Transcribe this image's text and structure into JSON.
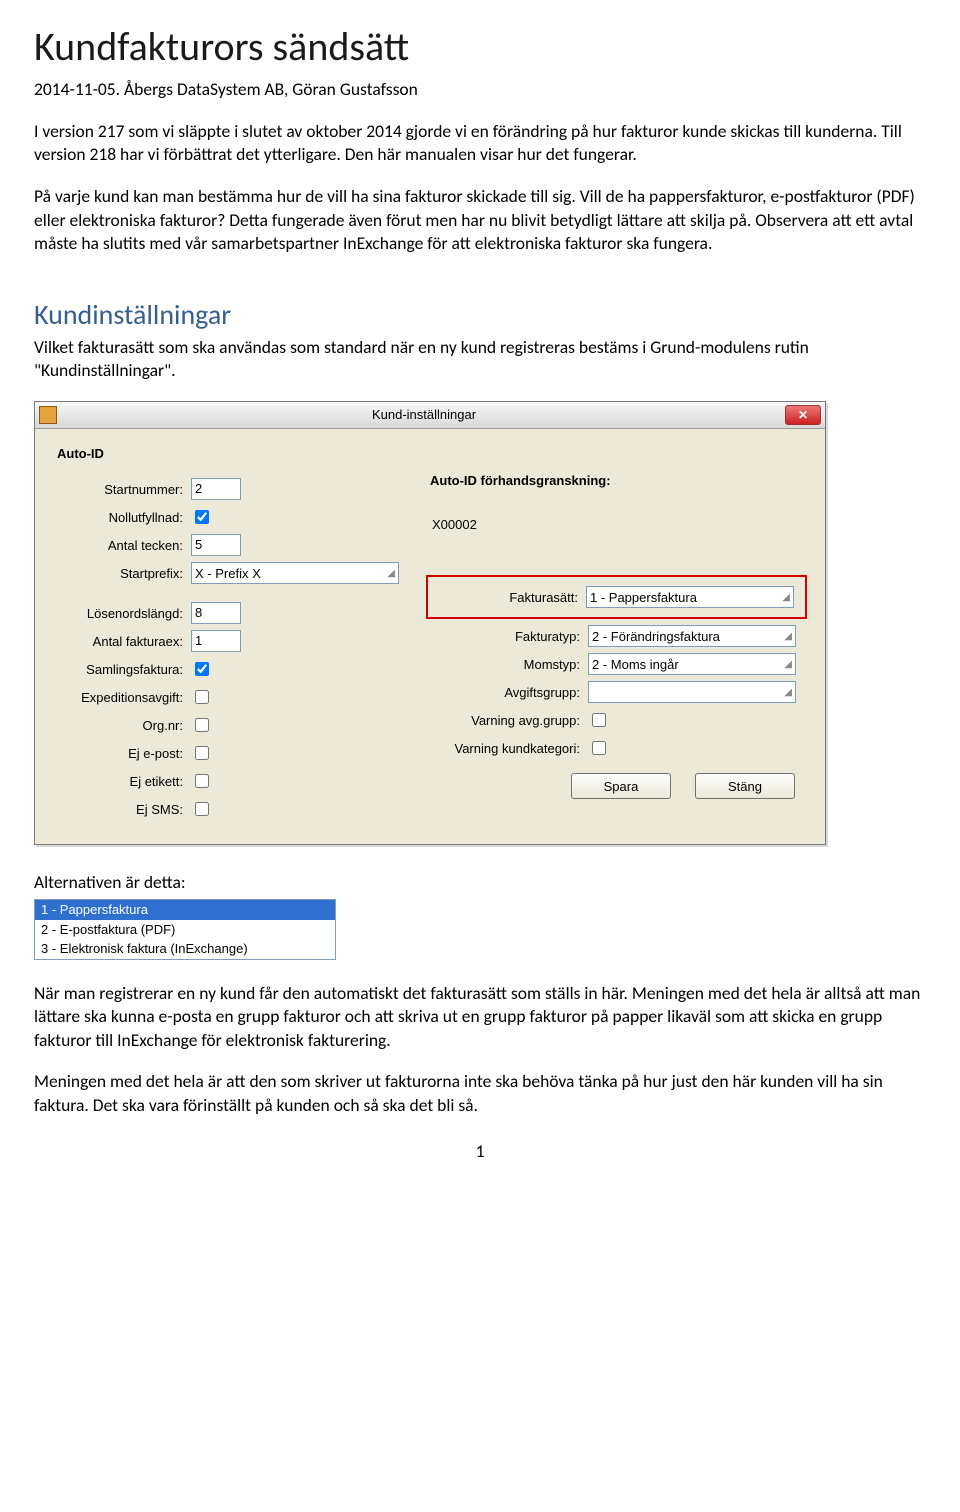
{
  "doc": {
    "title": "Kundfakturors sändsätt",
    "meta": "2014-11-05. Åbergs DataSystem AB, Göran Gustafsson",
    "intro": "I version 217 som vi släppte i slutet av oktober 2014 gjorde vi en förändring på hur fakturor kunde skickas till kunderna. Till version 218 har vi förbättrat det ytterligare. Den här manualen visar hur det fungerar.",
    "para2": "På varje kund kan man bestämma hur de vill ha sina fakturor skickade till sig. Vill de ha pappersfakturor, e-postfakturor (PDF) eller elektroniska fakturor? Detta fungerade även förut men har nu blivit betydligt lättare att skilja på. Observera att ett avtal måste ha slutits med vår samarbetspartner InExchange för att elektroniska fakturor ska fungera.",
    "section_heading": "Kundinställningar",
    "section_intro": "Vilket fakturasätt som ska användas som standard när en ny kund registreras bestäms i Grund-modulens rutin \"Kundinställningar\".",
    "alternatives_label": "Alternativen är detta:",
    "after1": "När man registrerar en ny kund får den automatiskt det fakturasätt som ställs in här. Meningen med det hela är alltså att man lättare ska kunna e-posta en grupp fakturor och att skriva ut en grupp fakturor på papper likaväl som att skicka en grupp fakturor till InExchange för elektronisk fakturering.",
    "after2": "Meningen med det hela är att den som skriver ut fakturorna inte ska behöva tänka på hur just den här kunden vill ha sin faktura. Det ska vara förinställt på kunden och så ska det bli så.",
    "page_number": "1"
  },
  "dialog": {
    "title": "Kund-inställningar",
    "group": "Auto-ID",
    "left_labels": {
      "startnummer": "Startnummer:",
      "nollutfyllnad": "Nollutfyllnad:",
      "antal_tecken": "Antal tecken:",
      "startprefix": "Startprefix:",
      "losenordslangd": "Lösenordslängd:",
      "antal_fakturaex": "Antal fakturaex:",
      "samlingsfaktura": "Samlingsfaktura:",
      "expeditionsavgift": "Expeditionsavgift:",
      "orgnr": "Org.nr:",
      "ej_epost": "Ej e-post:",
      "ej_etikett": "Ej etikett:",
      "ej_sms": "Ej SMS:"
    },
    "left_values": {
      "startnummer": "2",
      "antal_tecken": "5",
      "startprefix": "X  - Prefix X",
      "losenordslangd": "8",
      "antal_fakturaex": "1"
    },
    "right_labels": {
      "preview_header": "Auto-ID förhandsgranskning:",
      "preview_value": "X00002",
      "fakturasatt": "Fakturasätt:",
      "fakturatyp": "Fakturatyp:",
      "momstyp": "Momstyp:",
      "avgiftsgrupp": "Avgiftsgrupp:",
      "varning_avg": "Varning avg.grupp:",
      "varning_kund": "Varning kundkategori:"
    },
    "right_values": {
      "fakturasatt": "1   - Pappersfaktura",
      "fakturatyp": "2  - Förändringsfaktura",
      "momstyp": "2  - Moms ingår"
    },
    "buttons": {
      "save": "Spara",
      "close": "Stäng"
    }
  },
  "alternatives": [
    "1    - Pappersfaktura",
    "2    - E-postfaktura (PDF)",
    "3    - Elektronisk faktura (InExchange)"
  ]
}
